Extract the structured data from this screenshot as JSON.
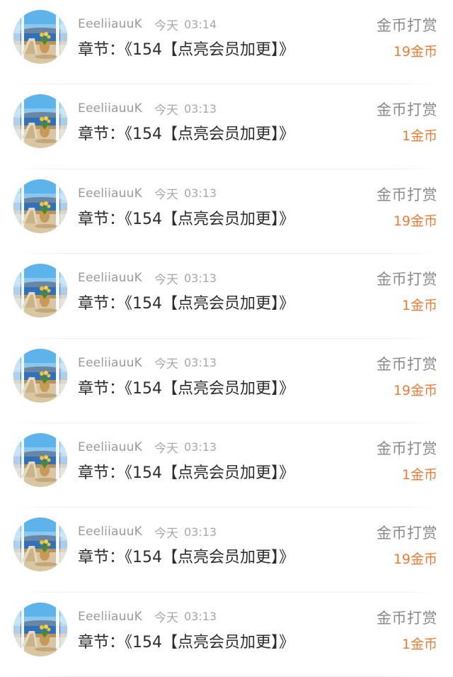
{
  "records": [
    {
      "username": "EeeliiauuK",
      "day": "今天",
      "time": "03:14",
      "chapter": "章节：《154【点亮会员加更】》",
      "action": "金币打赏",
      "amount": "19金币"
    },
    {
      "username": "EeeliiauuK",
      "day": "今天",
      "time": "03:13",
      "chapter": "章节：《154【点亮会员加更】》",
      "action": "金币打赏",
      "amount": "1金币"
    },
    {
      "username": "EeeliiauuK",
      "day": "今天",
      "time": "03:13",
      "chapter": "章节：《154【点亮会员加更】》",
      "action": "金币打赏",
      "amount": "19金币"
    },
    {
      "username": "EeeliiauuK",
      "day": "今天",
      "time": "03:13",
      "chapter": "章节：《154【点亮会员加更】》",
      "action": "金币打赏",
      "amount": "1金币"
    },
    {
      "username": "EeeliiauuK",
      "day": "今天",
      "time": "03:13",
      "chapter": "章节：《154【点亮会员加更】》",
      "action": "金币打赏",
      "amount": "19金币"
    },
    {
      "username": "EeeliiauuK",
      "day": "今天",
      "time": "03:13",
      "chapter": "章节：《154【点亮会员加更】》",
      "action": "金币打赏",
      "amount": "1金币"
    },
    {
      "username": "EeeliiauuK",
      "day": "今天",
      "time": "03:13",
      "chapter": "章节：《154【点亮会员加更】》",
      "action": "金币打赏",
      "amount": "19金币"
    },
    {
      "username": "EeeliiauuK",
      "day": "今天",
      "time": "03:13",
      "chapter": "章节：《154【点亮会员加更】》",
      "action": "金币打赏",
      "amount": "1金币"
    }
  ],
  "avatar_icon": "seaside-window-avatar-icon",
  "colors": {
    "amount": "#ef7b34",
    "action": "#8a8a8a",
    "meta": "#9a9a9a",
    "title": "#2d2d2d"
  }
}
